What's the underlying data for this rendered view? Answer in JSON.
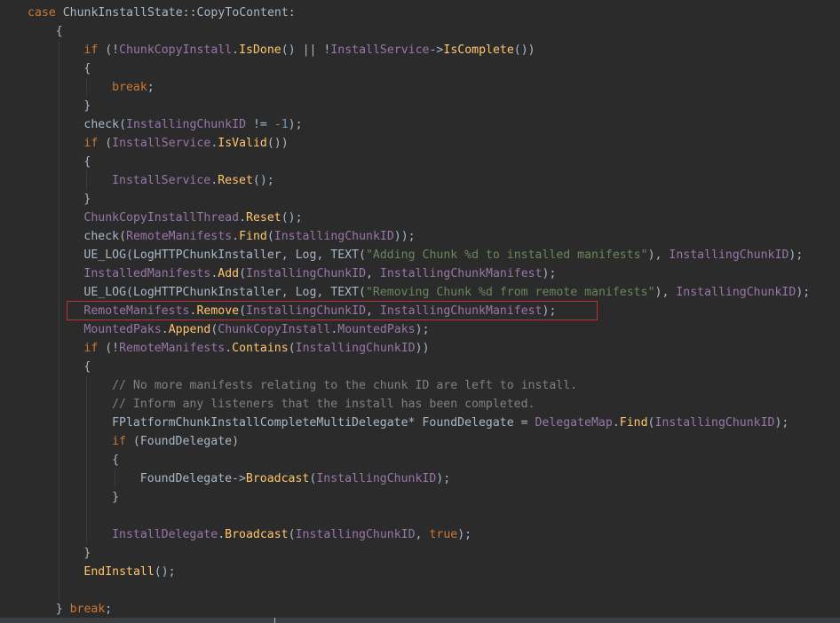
{
  "colors": {
    "background": "#2b2b2b",
    "plain": "#a9b7c6",
    "keyword": "#cc7832",
    "field": "#9876aa",
    "method": "#ffc66d",
    "string": "#6a8759",
    "number": "#6897bb",
    "comment": "#808080",
    "highlight": "#c0303a"
  },
  "code": {
    "lines": [
      {
        "indent": 0,
        "tokens": [
          [
            "keyword",
            "case "
          ],
          [
            "plain",
            "ChunkInstallState::CopyToContent:"
          ]
        ]
      },
      {
        "indent": 1,
        "tokens": [
          [
            "plain",
            "{"
          ]
        ]
      },
      {
        "indent": 2,
        "tokens": [
          [
            "keyword",
            "if "
          ],
          [
            "plain",
            "(!"
          ],
          [
            "field",
            "ChunkCopyInstall"
          ],
          [
            "plain",
            "."
          ],
          [
            "method",
            "IsDone"
          ],
          [
            "plain",
            "() || !"
          ],
          [
            "field",
            "InstallService"
          ],
          [
            "plain",
            "->"
          ],
          [
            "method",
            "IsComplete"
          ],
          [
            "plain",
            "())"
          ]
        ]
      },
      {
        "indent": 2,
        "tokens": [
          [
            "plain",
            "{"
          ]
        ]
      },
      {
        "indent": 3,
        "tokens": [
          [
            "keyword",
            "break"
          ],
          [
            "plain",
            ";"
          ]
        ]
      },
      {
        "indent": 2,
        "tokens": [
          [
            "plain",
            "}"
          ]
        ]
      },
      {
        "indent": 2,
        "tokens": [
          [
            "plain",
            "check("
          ],
          [
            "field",
            "InstallingChunkID"
          ],
          [
            "plain",
            " != "
          ],
          [
            "number",
            "-1"
          ],
          [
            "plain",
            ");"
          ]
        ]
      },
      {
        "indent": 2,
        "tokens": [
          [
            "keyword",
            "if "
          ],
          [
            "plain",
            "("
          ],
          [
            "field",
            "InstallService"
          ],
          [
            "plain",
            "."
          ],
          [
            "method",
            "IsValid"
          ],
          [
            "plain",
            "())"
          ]
        ]
      },
      {
        "indent": 2,
        "tokens": [
          [
            "plain",
            "{"
          ]
        ]
      },
      {
        "indent": 3,
        "tokens": [
          [
            "field",
            "InstallService"
          ],
          [
            "plain",
            "."
          ],
          [
            "method",
            "Reset"
          ],
          [
            "plain",
            "();"
          ]
        ]
      },
      {
        "indent": 2,
        "tokens": [
          [
            "plain",
            "}"
          ]
        ]
      },
      {
        "indent": 2,
        "tokens": [
          [
            "field",
            "ChunkCopyInstallThread"
          ],
          [
            "plain",
            "."
          ],
          [
            "method",
            "Reset"
          ],
          [
            "plain",
            "();"
          ]
        ]
      },
      {
        "indent": 2,
        "tokens": [
          [
            "plain",
            "check("
          ],
          [
            "field",
            "RemoteManifests"
          ],
          [
            "plain",
            "."
          ],
          [
            "method",
            "Find"
          ],
          [
            "plain",
            "("
          ],
          [
            "field",
            "InstallingChunkID"
          ],
          [
            "plain",
            "));"
          ]
        ]
      },
      {
        "indent": 2,
        "tokens": [
          [
            "plain",
            "UE_LOG(LogHTTPChunkInstaller, Log, TEXT("
          ],
          [
            "string",
            "\"Adding Chunk %d to installed manifests\""
          ],
          [
            "plain",
            "), "
          ],
          [
            "field",
            "InstallingChunkID"
          ],
          [
            "plain",
            ");"
          ]
        ]
      },
      {
        "indent": 2,
        "tokens": [
          [
            "field",
            "InstalledManifests"
          ],
          [
            "plain",
            "."
          ],
          [
            "method",
            "Add"
          ],
          [
            "plain",
            "("
          ],
          [
            "field",
            "InstallingChunkID"
          ],
          [
            "plain",
            ", "
          ],
          [
            "field",
            "InstallingChunkManifest"
          ],
          [
            "plain",
            ");"
          ]
        ]
      },
      {
        "indent": 2,
        "tokens": [
          [
            "plain",
            "UE_LOG(LogHTTPChunkInstaller, Log, TEXT("
          ],
          [
            "string",
            "\"Removing Chunk %d from remote manifests\""
          ],
          [
            "plain",
            "), "
          ],
          [
            "field",
            "InstallingChunkID"
          ],
          [
            "plain",
            ");"
          ]
        ]
      },
      {
        "indent": 2,
        "tokens": [
          [
            "field",
            "RemoteManifests"
          ],
          [
            "plain",
            "."
          ],
          [
            "method",
            "Remove"
          ],
          [
            "plain",
            "("
          ],
          [
            "field",
            "InstallingChunkID"
          ],
          [
            "plain",
            ", "
          ],
          [
            "field",
            "InstallingChunkManifest"
          ],
          [
            "plain",
            ");"
          ]
        ]
      },
      {
        "indent": 2,
        "tokens": [
          [
            "field",
            "MountedPaks"
          ],
          [
            "plain",
            "."
          ],
          [
            "method",
            "Append"
          ],
          [
            "plain",
            "("
          ],
          [
            "field",
            "ChunkCopyInstall"
          ],
          [
            "plain",
            "."
          ],
          [
            "field",
            "MountedPaks"
          ],
          [
            "plain",
            ");"
          ]
        ]
      },
      {
        "indent": 2,
        "tokens": [
          [
            "keyword",
            "if "
          ],
          [
            "plain",
            "(!"
          ],
          [
            "field",
            "RemoteManifests"
          ],
          [
            "plain",
            "."
          ],
          [
            "method",
            "Contains"
          ],
          [
            "plain",
            "("
          ],
          [
            "field",
            "InstallingChunkID"
          ],
          [
            "plain",
            "))"
          ]
        ]
      },
      {
        "indent": 2,
        "tokens": [
          [
            "plain",
            "{"
          ]
        ]
      },
      {
        "indent": 3,
        "tokens": [
          [
            "comment",
            "// No more manifests relating to the chunk ID are left to install."
          ]
        ]
      },
      {
        "indent": 3,
        "tokens": [
          [
            "comment",
            "// Inform any listeners that the install has been completed."
          ]
        ]
      },
      {
        "indent": 3,
        "tokens": [
          [
            "plain",
            "FPlatformChunkInstallCompleteMultiDelegate* FoundDelegate = "
          ],
          [
            "field",
            "DelegateMap"
          ],
          [
            "plain",
            "."
          ],
          [
            "method",
            "Find"
          ],
          [
            "plain",
            "("
          ],
          [
            "field",
            "InstallingChunkID"
          ],
          [
            "plain",
            ");"
          ]
        ]
      },
      {
        "indent": 3,
        "tokens": [
          [
            "keyword",
            "if "
          ],
          [
            "plain",
            "(FoundDelegate)"
          ]
        ]
      },
      {
        "indent": 3,
        "tokens": [
          [
            "plain",
            "{"
          ]
        ]
      },
      {
        "indent": 4,
        "tokens": [
          [
            "plain",
            "FoundDelegate->"
          ],
          [
            "method",
            "Broadcast"
          ],
          [
            "plain",
            "("
          ],
          [
            "field",
            "InstallingChunkID"
          ],
          [
            "plain",
            ");"
          ]
        ]
      },
      {
        "indent": 3,
        "tokens": [
          [
            "plain",
            "}"
          ]
        ]
      },
      {
        "indent": 0,
        "tokens": []
      },
      {
        "indent": 3,
        "tokens": [
          [
            "field",
            "InstallDelegate"
          ],
          [
            "plain",
            "."
          ],
          [
            "method",
            "Broadcast"
          ],
          [
            "plain",
            "("
          ],
          [
            "field",
            "InstallingChunkID"
          ],
          [
            "plain",
            ", "
          ],
          [
            "keyword",
            "true"
          ],
          [
            "plain",
            ");"
          ]
        ]
      },
      {
        "indent": 2,
        "tokens": [
          [
            "plain",
            "}"
          ]
        ]
      },
      {
        "indent": 2,
        "tokens": [
          [
            "method",
            "EndInstall"
          ],
          [
            "plain",
            "();"
          ]
        ]
      },
      {
        "indent": 0,
        "tokens": []
      },
      {
        "indent": 1,
        "tokens": [
          [
            "plain",
            "} "
          ],
          [
            "keyword",
            "break"
          ],
          [
            "plain",
            ";"
          ]
        ]
      }
    ]
  }
}
